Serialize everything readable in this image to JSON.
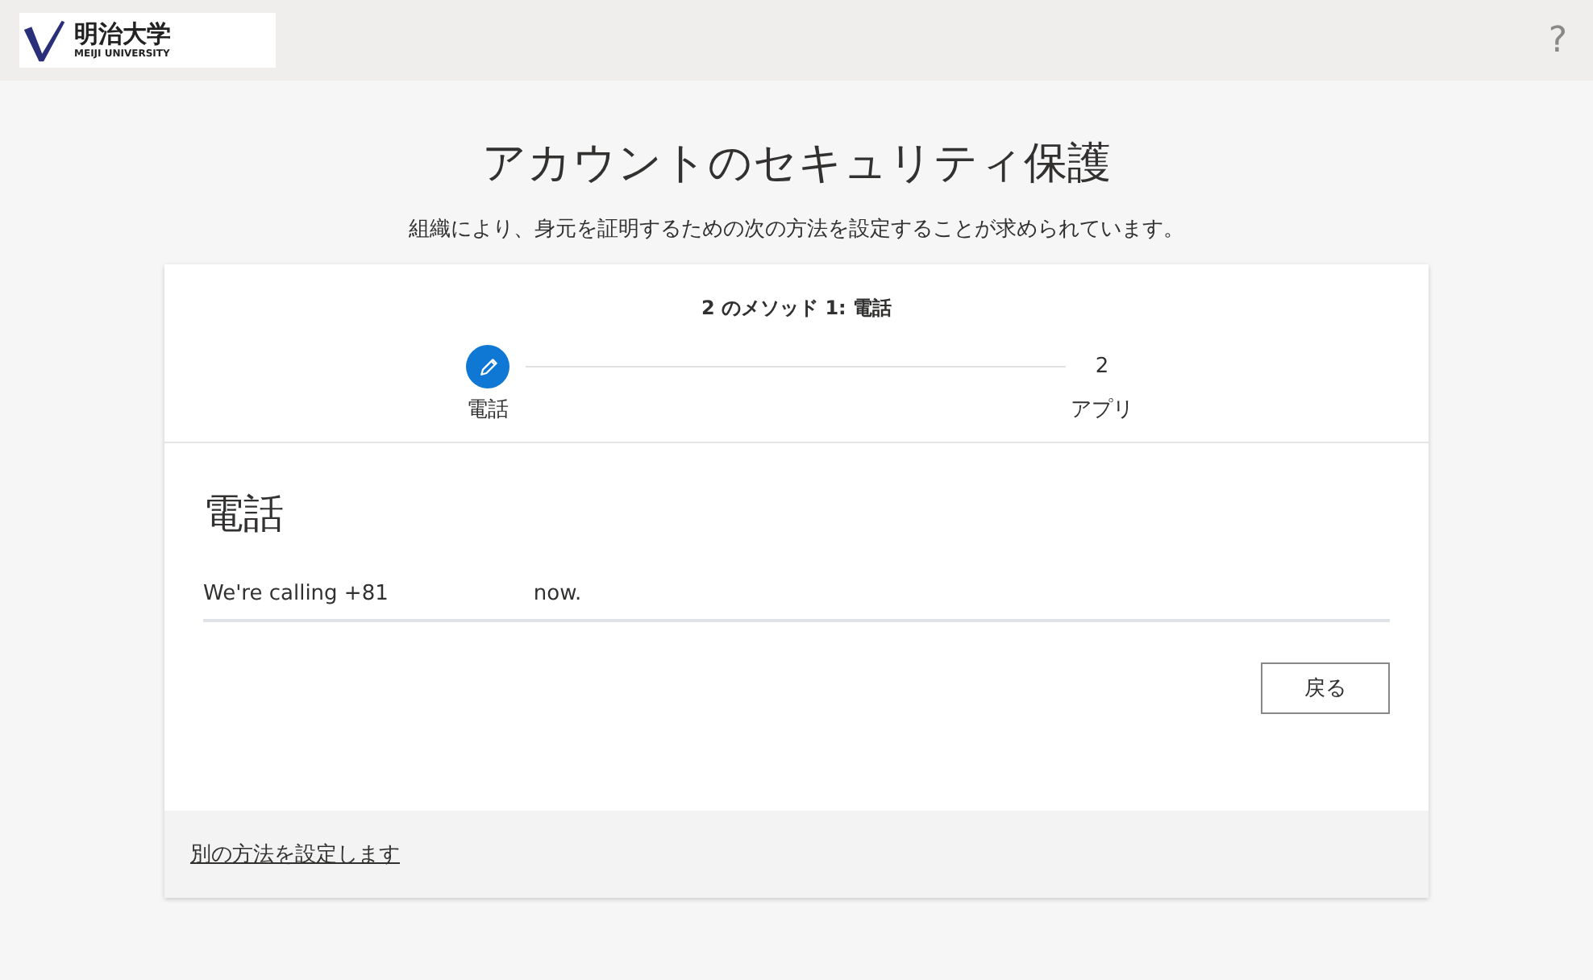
{
  "header": {
    "logo": {
      "name": "明治大学",
      "subtitle": "MEIJI UNIVERSITY"
    },
    "help": "?"
  },
  "title": "アカウントのセキュリティ保護",
  "subtitle": "組織により、身元を証明するための次の方法を設定することが求められています。",
  "card": {
    "step_heading": "2 のメソッド 1: 電話",
    "steps": [
      {
        "label": "電話",
        "current": true
      },
      {
        "number": "2",
        "label": "アプリ",
        "current": false
      }
    ],
    "section_title": "電話",
    "message": {
      "before": "We're calling +81",
      "after": "now."
    },
    "back_button": "戻る",
    "footer_link": "別の方法を設定します"
  }
}
